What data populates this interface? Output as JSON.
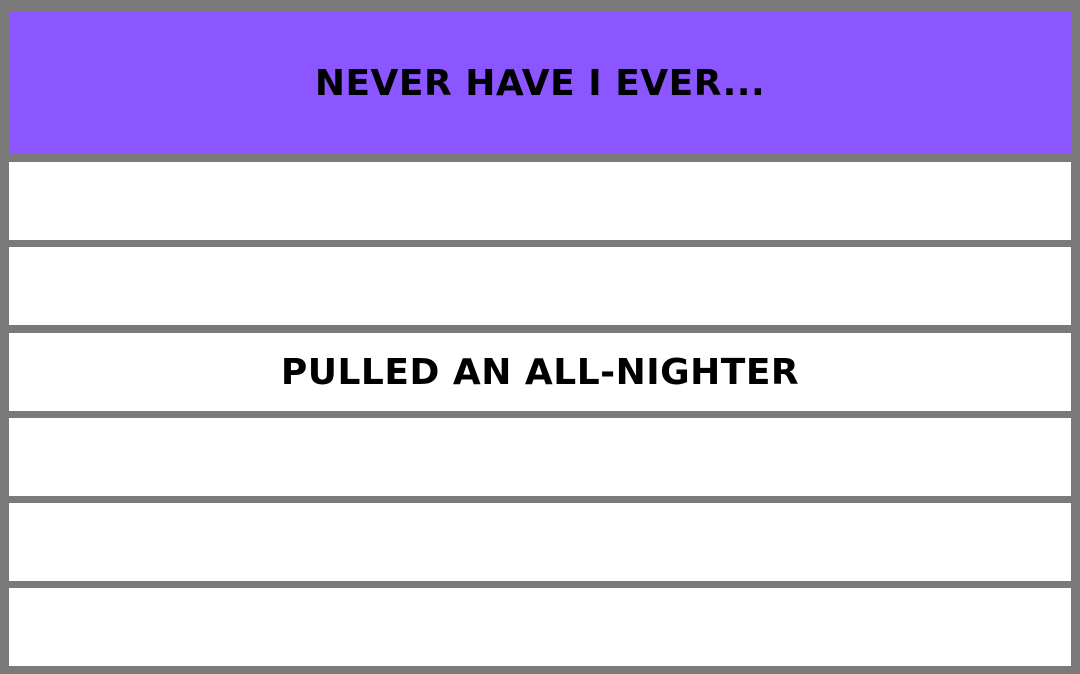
{
  "title": "NEVER HAVE I EVER...",
  "rows": [
    {
      "text": ""
    },
    {
      "text": ""
    },
    {
      "text": "PULLED AN ALL-NIGHTER"
    },
    {
      "text": ""
    },
    {
      "text": ""
    },
    {
      "text": ""
    }
  ],
  "colors": {
    "header_background": "#8b55ff",
    "frame": "#7a7a7a",
    "row_background": "#ffffff",
    "text": "#000000"
  }
}
